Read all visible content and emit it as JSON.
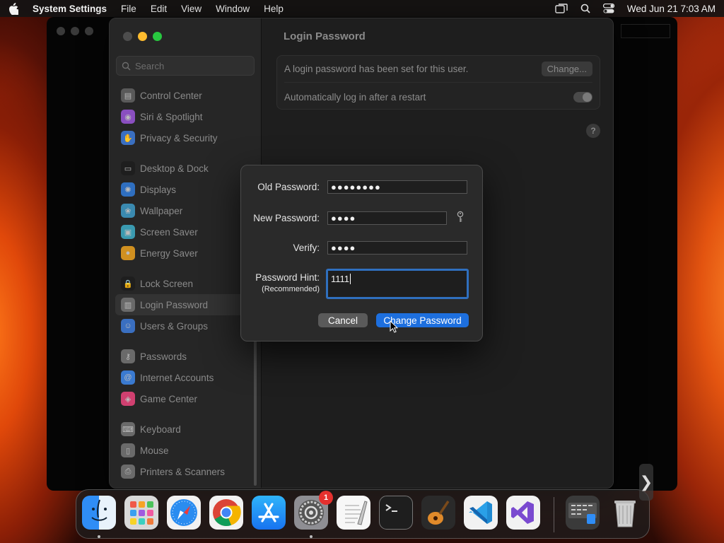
{
  "menubar": {
    "app_name": "System Settings",
    "menus": [
      "File",
      "Edit",
      "View",
      "Window",
      "Help"
    ],
    "datetime": "Wed Jun 21  7:03 AM"
  },
  "sidebar": {
    "search_placeholder": "Search",
    "sections": [
      [
        {
          "label": "Control Center",
          "icon": "control-center-icon",
          "color": "#5a5a5a"
        },
        {
          "label": "Siri & Spotlight",
          "icon": "siri-icon",
          "color": "#8a4fc0"
        },
        {
          "label": "Privacy & Security",
          "icon": "hand-icon",
          "color": "#3a6fc0"
        }
      ],
      [
        {
          "label": "Desktop & Dock",
          "icon": "dock-icon",
          "color": "#1e1e1e"
        },
        {
          "label": "Displays",
          "icon": "sun-icon",
          "color": "#2f6fc0"
        },
        {
          "label": "Wallpaper",
          "icon": "wallpaper-icon",
          "color": "#3a8ab0"
        },
        {
          "label": "Screen Saver",
          "icon": "screen-saver-icon",
          "color": "#3a9ab0"
        },
        {
          "label": "Energy Saver",
          "icon": "bulb-icon",
          "color": "#d09020"
        }
      ],
      [
        {
          "label": "Lock Screen",
          "icon": "lock-icon",
          "color": "#1e1e1e"
        },
        {
          "label": "Login Password",
          "icon": "login-password-icon",
          "color": "#6a6a6a",
          "selected": true
        },
        {
          "label": "Users & Groups",
          "icon": "users-icon",
          "color": "#3a6fc0"
        }
      ],
      [
        {
          "label": "Passwords",
          "icon": "key-icon",
          "color": "#6a6a6a"
        },
        {
          "label": "Internet Accounts",
          "icon": "at-icon",
          "color": "#3a7ad0"
        },
        {
          "label": "Game Center",
          "icon": "game-center-icon",
          "color": "#d04070"
        }
      ],
      [
        {
          "label": "Keyboard",
          "icon": "keyboard-icon",
          "color": "#6a6a6a"
        },
        {
          "label": "Mouse",
          "icon": "mouse-icon",
          "color": "#6a6a6a"
        },
        {
          "label": "Printers & Scanners",
          "icon": "printer-icon",
          "color": "#6a6a6a"
        }
      ]
    ]
  },
  "content": {
    "title": "Login Password",
    "row1_text": "A login password has been set for this user.",
    "change_label": "Change...",
    "row2_text": "Automatically log in after a restart",
    "help_label": "?"
  },
  "dialog": {
    "old_label": "Old Password:",
    "old_value": "●●●●●●●●",
    "new_label": "New Password:",
    "new_value": "●●●●",
    "verify_label": "Verify:",
    "verify_value": "●●●●",
    "hint_label": "Password Hint:",
    "hint_sub": "(Recommended)",
    "hint_value": "1111",
    "cancel_label": "Cancel",
    "change_label": "Change Password"
  },
  "dock": {
    "badge_count": "1",
    "apps": [
      "finder",
      "launchpad",
      "safari",
      "chrome",
      "app-store",
      "system-settings",
      "textedit",
      "terminal",
      "garageband",
      "vscode",
      "visual-studio",
      "downloads",
      "trash"
    ]
  },
  "colors": {
    "accent": "#1d6fde",
    "focus_ring": "#2f6fbe"
  }
}
